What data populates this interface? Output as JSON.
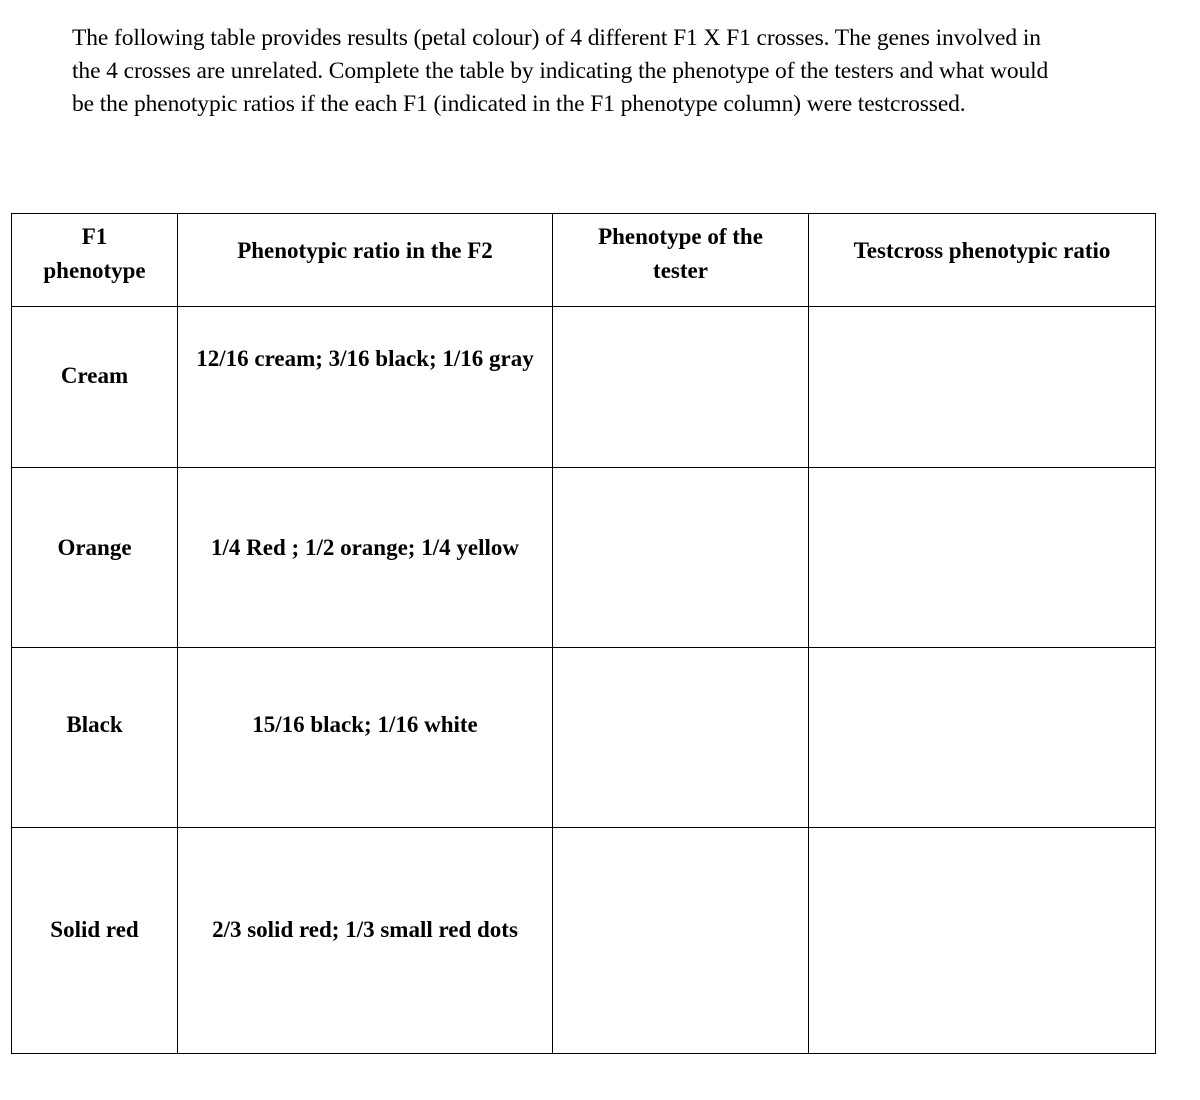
{
  "document": {
    "intro_text": "The following table provides results (petal colour) of 4 different F1 X F1 crosses. The genes involved in the 4 crosses are unrelated. Complete the table by indicating the phenotype of the testers and what would be the phenotypic ratios if the each F1 (indicated in the F1 phenotype column) were testcrossed."
  },
  "table": {
    "headers": {
      "f1_phenotype_line1": "F1",
      "f1_phenotype_line2": "phenotype",
      "f2_ratio": "Phenotypic ratio in the F2",
      "tester_line1": "Phenotype of the",
      "tester_line2": "tester",
      "testcross_ratio": "Testcross phenotypic ratio"
    },
    "rows": [
      {
        "f1_phenotype": "Cream",
        "f2_ratio": "12/16 cream; 3/16 black; 1/16 gray",
        "tester_phenotype": "",
        "testcross_ratio": ""
      },
      {
        "f1_phenotype": "Orange",
        "f2_ratio": "1/4 Red ; 1/2 orange; 1/4 yellow",
        "tester_phenotype": "",
        "testcross_ratio": ""
      },
      {
        "f1_phenotype": "Black",
        "f2_ratio": "15/16 black; 1/16 white",
        "tester_phenotype": "",
        "testcross_ratio": ""
      },
      {
        "f1_phenotype": "Solid red",
        "f2_ratio": "2/3 solid red; 1/3 small red dots",
        "tester_phenotype": "",
        "testcross_ratio": ""
      }
    ]
  }
}
